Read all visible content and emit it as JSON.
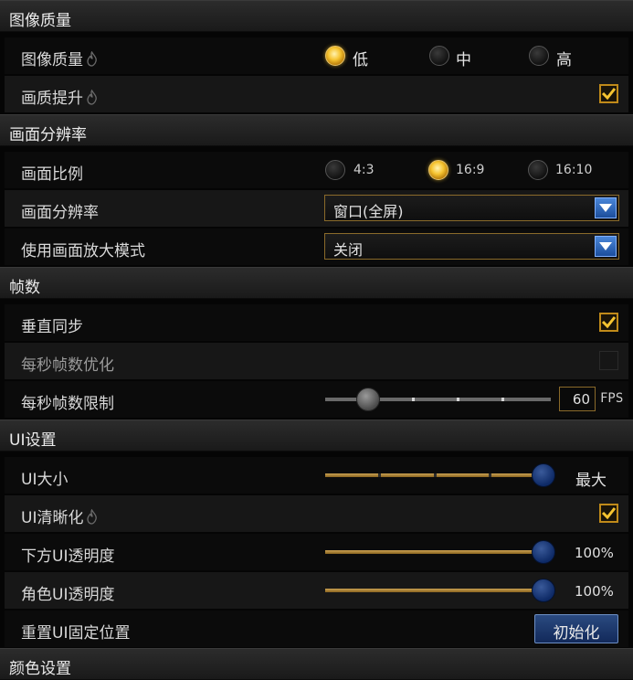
{
  "sections": {
    "image_quality": "图像质量",
    "resolution": "画面分辨率",
    "frame_rate": "帧数",
    "ui_settings": "UI设置",
    "color_settings": "颜色设置"
  },
  "image_quality": {
    "quality_label": "图像质量",
    "options": [
      "低",
      "中",
      "高"
    ],
    "selected": "低",
    "enhance_label": "画质提升",
    "enhance_checked": true
  },
  "resolution": {
    "ratio_label": "画面比例",
    "ratio_options": [
      "4:3",
      "16:9",
      "16:10"
    ],
    "ratio_selected": "16:9",
    "resolution_label": "画面分辨率",
    "resolution_value": "窗口(全屏)",
    "zoom_label": "使用画面放大模式",
    "zoom_value": "关闭"
  },
  "frame_rate": {
    "vsync_label": "垂直同步",
    "vsync_checked": true,
    "optimize_label": "每秒帧数优化",
    "optimize_checked": false,
    "limit_label": "每秒帧数限制",
    "limit_value": "60",
    "limit_unit": "FPS"
  },
  "ui": {
    "size_label": "UI大小",
    "size_value": "最大",
    "sharpen_label": "UI清晰化",
    "sharpen_checked": true,
    "bottom_opacity_label": "下方UI透明度",
    "bottom_opacity_value": "100%",
    "char_opacity_label": "角色UI透明度",
    "char_opacity_value": "100%",
    "reset_label": "重置UI固定位置",
    "reset_button": "初始化"
  },
  "colors": {
    "accent_gold": "#f6c431",
    "border_gold": "#8a6a2a",
    "button_blue": "#1c4e9c"
  }
}
